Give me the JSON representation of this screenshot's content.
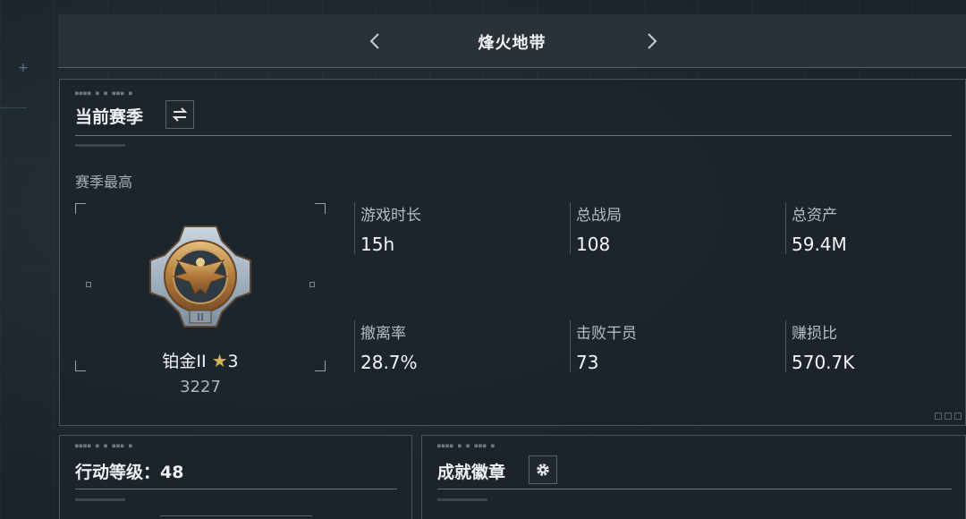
{
  "header": {
    "title": "烽火地带"
  },
  "season_panel": {
    "title": "当前赛季",
    "subtitle": "赛季最高",
    "rank": {
      "name": "铂金II",
      "stars": "3",
      "score": "3227",
      "emblem_numeral": "II"
    },
    "stats": [
      {
        "label": "游戏时长",
        "value": "15h"
      },
      {
        "label": "总战局",
        "value": "108"
      },
      {
        "label": "总资产",
        "value": "59.4M"
      },
      {
        "label": "撤离率",
        "value": "28.7%"
      },
      {
        "label": "击败干员",
        "value": "73"
      },
      {
        "label": "赚损比",
        "value": "570.7K"
      }
    ]
  },
  "level_panel": {
    "title": "行动等级：48"
  },
  "badge_panel": {
    "title": "成就徽章"
  },
  "icons": {
    "prev": "chevron-left-icon",
    "next": "chevron-right-icon",
    "switch": "swap-arrows-icon",
    "settings": "gear-icon",
    "star": "star-icon"
  },
  "colors": {
    "background": "#1b242c",
    "panel": "#1c242b",
    "border": "#4a545b",
    "gold": "#d4b25a"
  }
}
